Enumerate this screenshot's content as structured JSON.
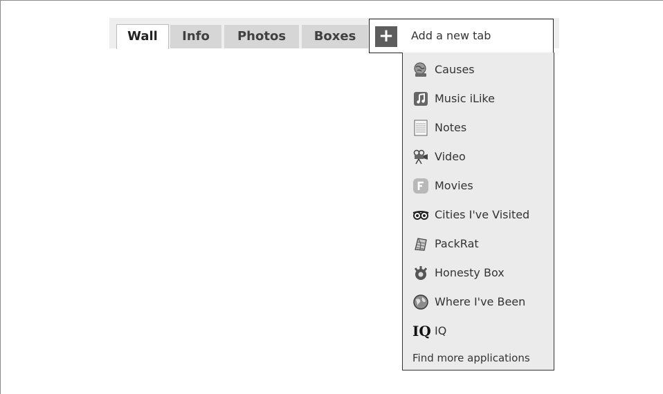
{
  "tabs": [
    {
      "label": "Wall",
      "active": true
    },
    {
      "label": "Info"
    },
    {
      "label": "Photos"
    },
    {
      "label": "Boxes"
    }
  ],
  "add_tab": {
    "plus_symbol": "+",
    "label": "Add a new tab"
  },
  "menu": {
    "items": [
      {
        "label": "Causes",
        "icon": "causes-globe-icon"
      },
      {
        "label": "Music iLike",
        "icon": "music-note-icon"
      },
      {
        "label": "Notes",
        "icon": "notes-page-icon"
      },
      {
        "label": "Video",
        "icon": "video-camera-icon"
      },
      {
        "label": "Movies",
        "icon": "flixster-f-icon"
      },
      {
        "label": "Cities I've Visited",
        "icon": "owl-eyes-icon"
      },
      {
        "label": "PackRat",
        "icon": "packrat-icon"
      },
      {
        "label": "Honesty Box",
        "icon": "honesty-box-icon"
      },
      {
        "label": "Where I've Been",
        "icon": "globe-icon"
      },
      {
        "label": "IQ",
        "icon": "iq-icon",
        "glyph": "IQ"
      }
    ],
    "find_more": "Find more applications"
  },
  "colors": {
    "tab_bar_bg": "#eeeeee",
    "tab_bg": "#d6d6d6",
    "dropdown_bg": "#ebebeb",
    "plus_bg": "#5d5d5d"
  }
}
